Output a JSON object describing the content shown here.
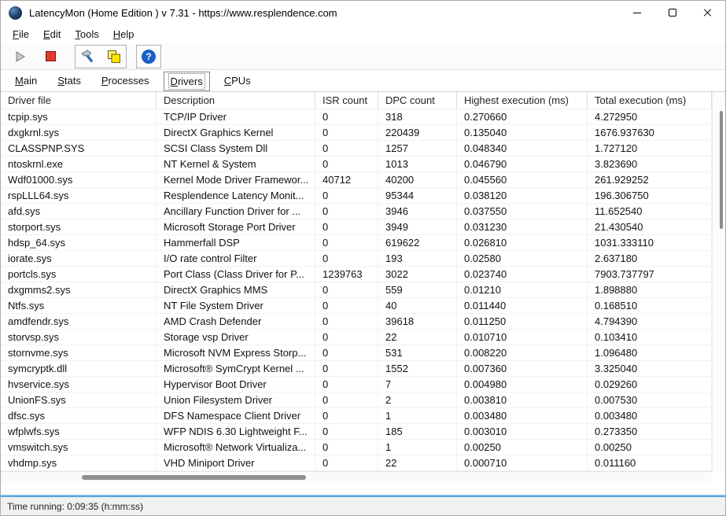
{
  "colors": {
    "accent_blue": "#3f97d8",
    "stop_red": "#e03a2f",
    "copy_yellow": "#ffe600",
    "help_blue": "#1a5fc8"
  },
  "window": {
    "title": "LatencyMon  (Home Edition )  v 7.31 - https://www.resplendence.com"
  },
  "menu": {
    "items": [
      {
        "label": "File"
      },
      {
        "label": "Edit"
      },
      {
        "label": "Tools"
      },
      {
        "label": "Help"
      }
    ]
  },
  "toolbar": {
    "buttons": [
      {
        "name": "start-monitor",
        "icon": "play-icon"
      },
      {
        "name": "stop-monitor",
        "icon": "stop-icon"
      },
      {
        "name": "tools",
        "icon": "wrench-icon"
      },
      {
        "name": "copy-report",
        "icon": "copy-icon"
      },
      {
        "name": "help",
        "icon": "help-icon"
      }
    ],
    "help_glyph": "?"
  },
  "tabs": [
    {
      "label": "Main",
      "active": false
    },
    {
      "label": "Stats",
      "active": false
    },
    {
      "label": "Processes",
      "active": false
    },
    {
      "label": "Drivers",
      "active": true
    },
    {
      "label": "CPUs",
      "active": false
    }
  ],
  "table": {
    "columns": [
      "Driver file",
      "Description",
      "ISR count",
      "DPC count",
      "Highest execution (ms)",
      "Total execution (ms)"
    ],
    "rows": [
      [
        "tcpip.sys",
        "TCP/IP Driver",
        "0",
        "318",
        "0.270660",
        "4.272950"
      ],
      [
        "dxgkrnl.sys",
        "DirectX Graphics Kernel",
        "0",
        "220439",
        "0.135040",
        "1676.937630"
      ],
      [
        "CLASSPNP.SYS",
        "SCSI Class System Dll",
        "0",
        "1257",
        "0.048340",
        "1.727120"
      ],
      [
        "ntoskrnl.exe",
        "NT Kernel & System",
        "0",
        "1013",
        "0.046790",
        "3.823690"
      ],
      [
        "Wdf01000.sys",
        "Kernel Mode Driver Framewor...",
        "40712",
        "40200",
        "0.045560",
        "261.929252"
      ],
      [
        "rspLLL64.sys",
        "Resplendence Latency Monit...",
        "0",
        "95344",
        "0.038120",
        "196.306750"
      ],
      [
        "afd.sys",
        "Ancillary Function Driver for ...",
        "0",
        "3946",
        "0.037550",
        "11.652540"
      ],
      [
        "storport.sys",
        "Microsoft Storage Port Driver",
        "0",
        "3949",
        "0.031230",
        "21.430540"
      ],
      [
        "hdsp_64.sys",
        "Hammerfall DSP",
        "0",
        "619622",
        "0.026810",
        "1031.333110"
      ],
      [
        "iorate.sys",
        "I/O rate control Filter",
        "0",
        "193",
        "0.02580",
        "2.637180"
      ],
      [
        "portcls.sys",
        "Port Class (Class Driver for P...",
        "1239763",
        "3022",
        "0.023740",
        "7903.737797"
      ],
      [
        "dxgmms2.sys",
        "DirectX Graphics MMS",
        "0",
        "559",
        "0.01210",
        "1.898880"
      ],
      [
        "Ntfs.sys",
        "NT File System Driver",
        "0",
        "40",
        "0.011440",
        "0.168510"
      ],
      [
        "amdfendr.sys",
        "AMD Crash Defender",
        "0",
        "39618",
        "0.011250",
        "4.794390"
      ],
      [
        "storvsp.sys",
        "Storage vsp Driver",
        "0",
        "22",
        "0.010710",
        "0.103410"
      ],
      [
        "stornvme.sys",
        "Microsoft NVM Express Storp...",
        "0",
        "531",
        "0.008220",
        "1.096480"
      ],
      [
        "symcryptk.dll",
        "Microsoft® SymCrypt Kernel ...",
        "0",
        "1552",
        "0.007360",
        "3.325040"
      ],
      [
        "hvservice.sys",
        "Hypervisor Boot Driver",
        "0",
        "7",
        "0.004980",
        "0.029260"
      ],
      [
        "UnionFS.sys",
        "Union Filesystem Driver",
        "0",
        "2",
        "0.003810",
        "0.007530"
      ],
      [
        "dfsc.sys",
        "DFS Namespace Client Driver",
        "0",
        "1",
        "0.003480",
        "0.003480"
      ],
      [
        "wfplwfs.sys",
        "WFP NDIS 6.30 Lightweight F...",
        "0",
        "185",
        "0.003010",
        "0.273350"
      ],
      [
        "vmswitch.sys",
        "Microsoft® Network Virtualiza...",
        "0",
        "1",
        "0.00250",
        "0.00250"
      ],
      [
        "vhdmp.sys",
        "VHD Miniport Driver",
        "0",
        "22",
        "0.000710",
        "0.011160"
      ]
    ]
  },
  "statusbar": {
    "text": "Time running: 0:09:35  (h:mm:ss)"
  }
}
